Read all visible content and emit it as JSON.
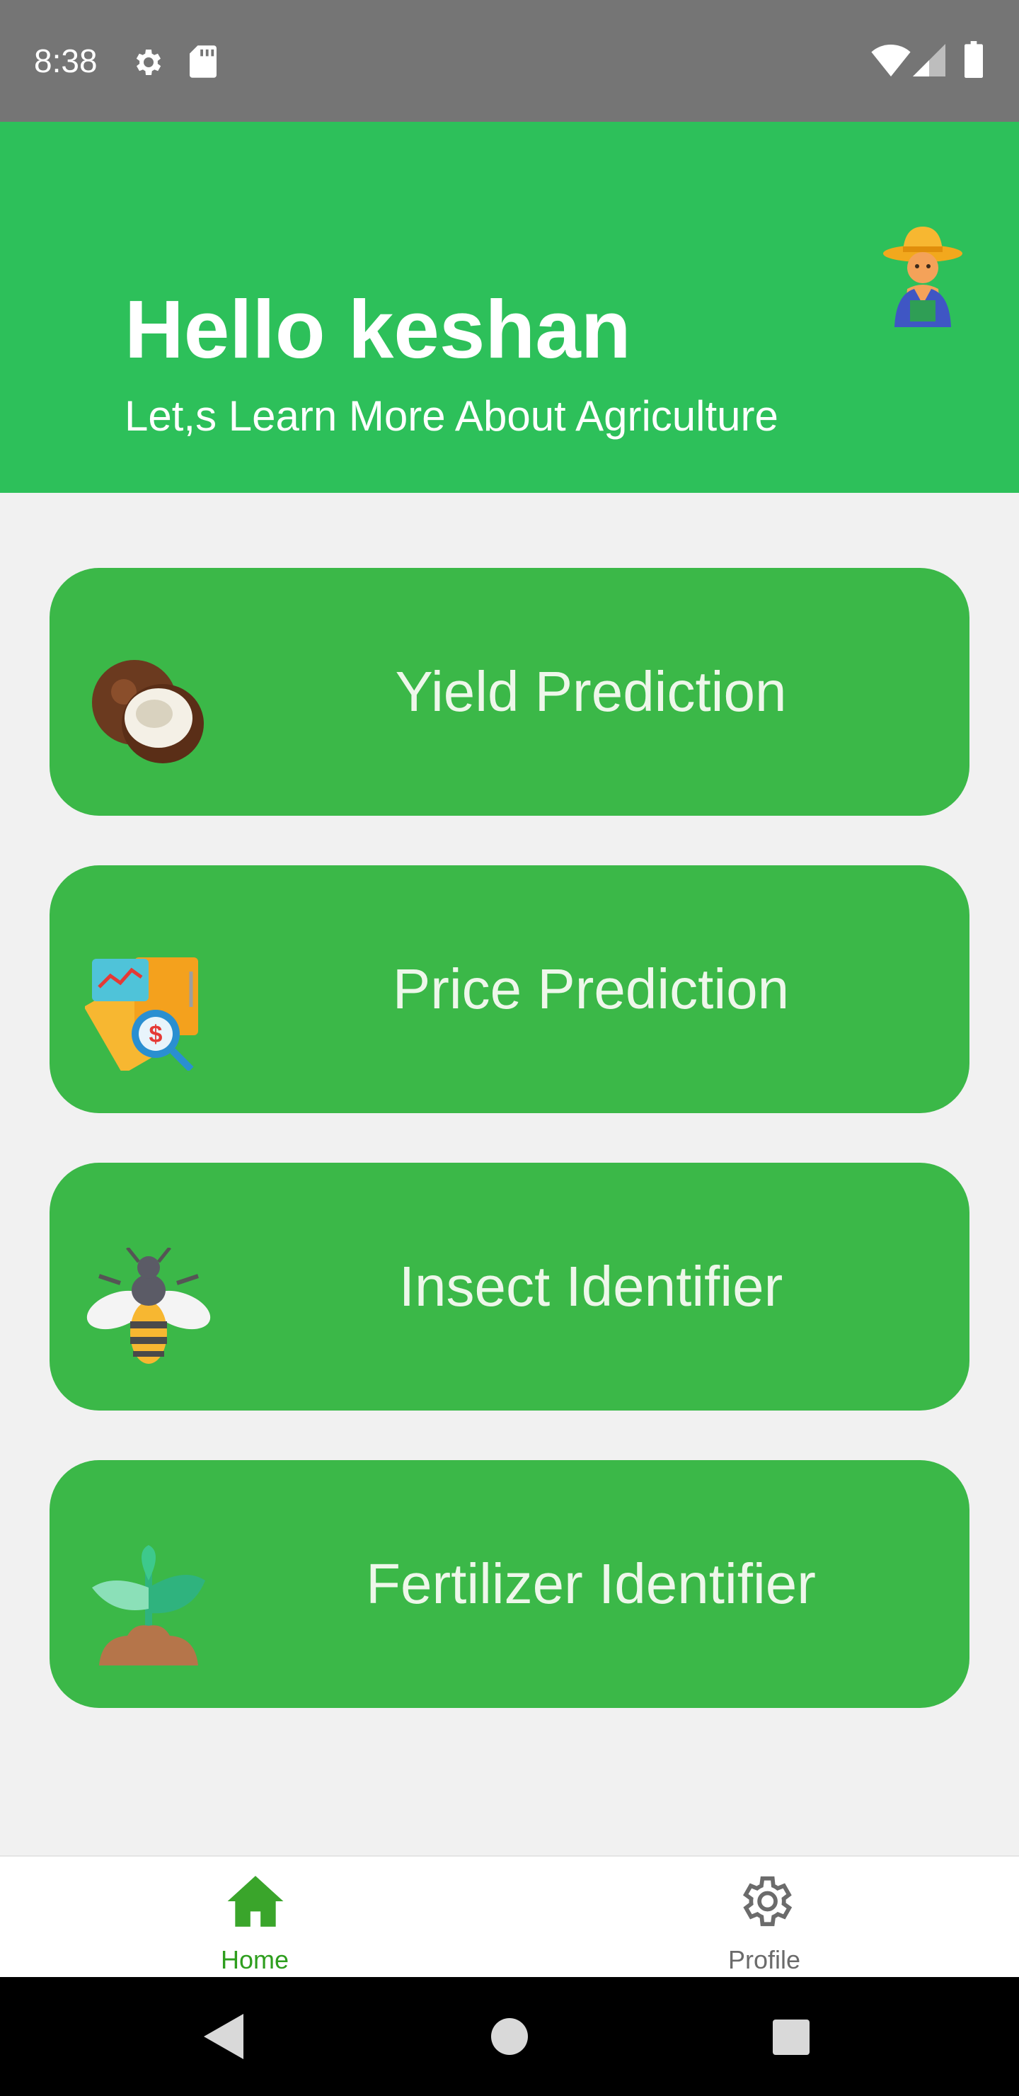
{
  "status_bar": {
    "time": "8:38",
    "icons": [
      "gear-icon",
      "sd-card-icon",
      "wifi-icon",
      "signal-icon",
      "battery-icon"
    ]
  },
  "header": {
    "greeting": "Hello keshan",
    "subtitle": "Let,s Learn More About Agriculture",
    "avatar_icon": "farmer-avatar-icon"
  },
  "menu": [
    {
      "label": "Yield Prediction",
      "icon": "coconut-icon"
    },
    {
      "label": "Price Prediction",
      "icon": "price-chart-icon"
    },
    {
      "label": "Insect Identifier",
      "icon": "bee-icon"
    },
    {
      "label": "Fertilizer Identifier",
      "icon": "plant-icon"
    }
  ],
  "bottom_nav": {
    "home_label": "Home",
    "profile_label": "Profile",
    "active": "Home"
  },
  "colors": {
    "header": "#2dc05a",
    "card": "#3bb848",
    "nav_active": "#2e9e1e",
    "status_bar": "#757575"
  }
}
